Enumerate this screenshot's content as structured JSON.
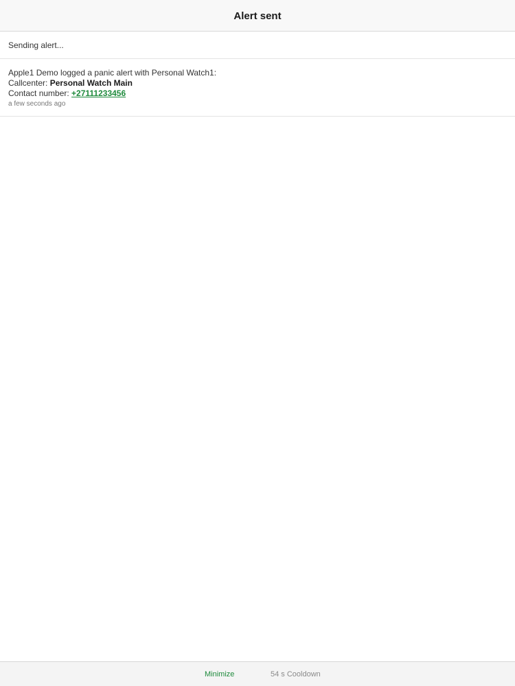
{
  "header": {
    "title": "Alert sent"
  },
  "status": {
    "sending_text": "Sending alert..."
  },
  "alert": {
    "message": "Apple1 Demo logged a panic alert with Personal Watch1:",
    "callcenter_label": "Callcenter: ",
    "callcenter_value": "Personal Watch Main",
    "contact_label": "Contact number: ",
    "contact_value": "+27111233456",
    "timestamp": "a few seconds ago"
  },
  "footer": {
    "minimize_label": "Minimize",
    "cooldown_label": "54 s Cooldown"
  },
  "colors": {
    "accent": "#1e8a3c",
    "muted": "#8a8a8a"
  }
}
